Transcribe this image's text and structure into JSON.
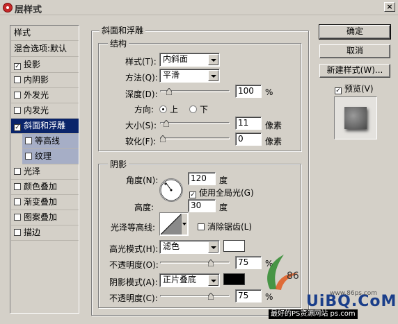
{
  "window": {
    "title": "层样式",
    "close": "×"
  },
  "left": {
    "header": "样式",
    "blend": "混合选项:默认",
    "items": [
      {
        "label": "投影",
        "checked": true
      },
      {
        "label": "内阴影",
        "checked": false
      },
      {
        "label": "外发光",
        "checked": false
      },
      {
        "label": "内发光",
        "checked": false
      },
      {
        "label": "斜面和浮雕",
        "checked": true
      },
      {
        "label": "等高线",
        "checked": false
      },
      {
        "label": "纹理",
        "checked": false
      },
      {
        "label": "光泽",
        "checked": false
      },
      {
        "label": "颜色叠加",
        "checked": false
      },
      {
        "label": "渐变叠加",
        "checked": false
      },
      {
        "label": "图案叠加",
        "checked": false
      },
      {
        "label": "描边",
        "checked": false
      }
    ]
  },
  "bevel": {
    "title": "斜面和浮雕",
    "structure": "结构",
    "style_label": "样式(T):",
    "style_value": "内斜面",
    "method_label": "方法(Q):",
    "method_value": "平滑",
    "depth_label": "深度(D):",
    "depth_value": "100",
    "depth_unit": "%",
    "depth_level": 0.1,
    "direction_label": "方向:",
    "dir_up": "上",
    "dir_down": "下",
    "size_label": "大小(S):",
    "size_value": "11",
    "size_unit": "像素",
    "size_level": 0.05,
    "soften_label": "软化(F):",
    "soften_value": "0",
    "soften_unit": "像素",
    "soften_level": 0
  },
  "shading": {
    "title": "阴影",
    "angle_label": "角度(N):",
    "angle_value": "120",
    "angle_unit": "度",
    "global_light": "使用全局光(G)",
    "altitude_label": "高度:",
    "altitude_value": "30",
    "altitude_unit": "度",
    "gloss_label": "光泽等高线:",
    "antialias": "消除锯齿(L)",
    "hl_mode_label": "高光模式(H):",
    "hl_mode_value": "滤色",
    "hl_color": "#ffffff",
    "hl_opacity_label": "不透明度(O):",
    "hl_opacity_value": "75",
    "hl_opacity_unit": "%",
    "hl_opacity_level": 0.75,
    "sh_mode_label": "阴影模式(A):",
    "sh_mode_value": "正片叠底",
    "sh_color": "#000000",
    "sh_opacity_label": "不透明度(C):",
    "sh_opacity_value": "75",
    "sh_opacity_unit": "%",
    "sh_opacity_level": 0.75
  },
  "buttons": {
    "ok": "确定",
    "cancel": "取消",
    "new_style": "新建样式(W)...",
    "preview": "预览(V)"
  },
  "watermark": {
    "brand": "UiBQ.CoM",
    "url": "www.86ps.com",
    "caption": "最好的PS资源网站 ps.com"
  }
}
